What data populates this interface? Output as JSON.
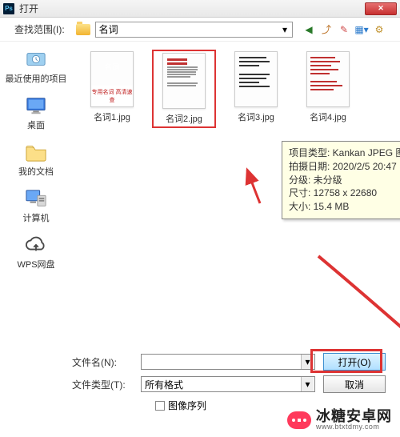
{
  "title": "打开",
  "ps_icon_label": "Ps",
  "close_icon": "✕",
  "lookin_label": "查找范围(I):",
  "lookin_value": "名词",
  "toolbar_icons": [
    "back-icon",
    "up-icon",
    "new-folder-icon",
    "view-icon",
    "settings-icon"
  ],
  "sidebar": {
    "items": [
      {
        "label": "最近使用的项目",
        "icon": "recent-icon"
      },
      {
        "label": "桌面",
        "icon": "desktop-icon"
      },
      {
        "label": "我的文档",
        "icon": "documents-icon"
      },
      {
        "label": "计算机",
        "icon": "computer-icon"
      },
      {
        "label": "WPS网盘",
        "icon": "cloud-icon"
      }
    ]
  },
  "files": [
    {
      "name": "名词1.jpg"
    },
    {
      "name": "名词2.jpg"
    },
    {
      "name": "名词3.jpg"
    },
    {
      "name": "名词4.jpg"
    }
  ],
  "tooltip": {
    "line1": "项目类型: Kankan JPEG 图像",
    "line2": "拍摄日期: 2020/2/5 20:47",
    "line3": "分级: 未分级",
    "line4": "尺寸: 12758 x 22680",
    "line5": "大小: 15.4 MB"
  },
  "fields": {
    "filename_label": "文件名(N):",
    "filename_value": "",
    "filetype_label": "文件类型(T):",
    "filetype_value": "所有格式"
  },
  "buttons": {
    "open": "打开(O)",
    "cancel": "取消"
  },
  "checkbox_label": "图像序列",
  "watermark": {
    "cn": "冰糖安卓网",
    "en": "www.btxtdmy.com"
  },
  "cover_title": "名词",
  "cover_sub": "专用名词 高清速查"
}
